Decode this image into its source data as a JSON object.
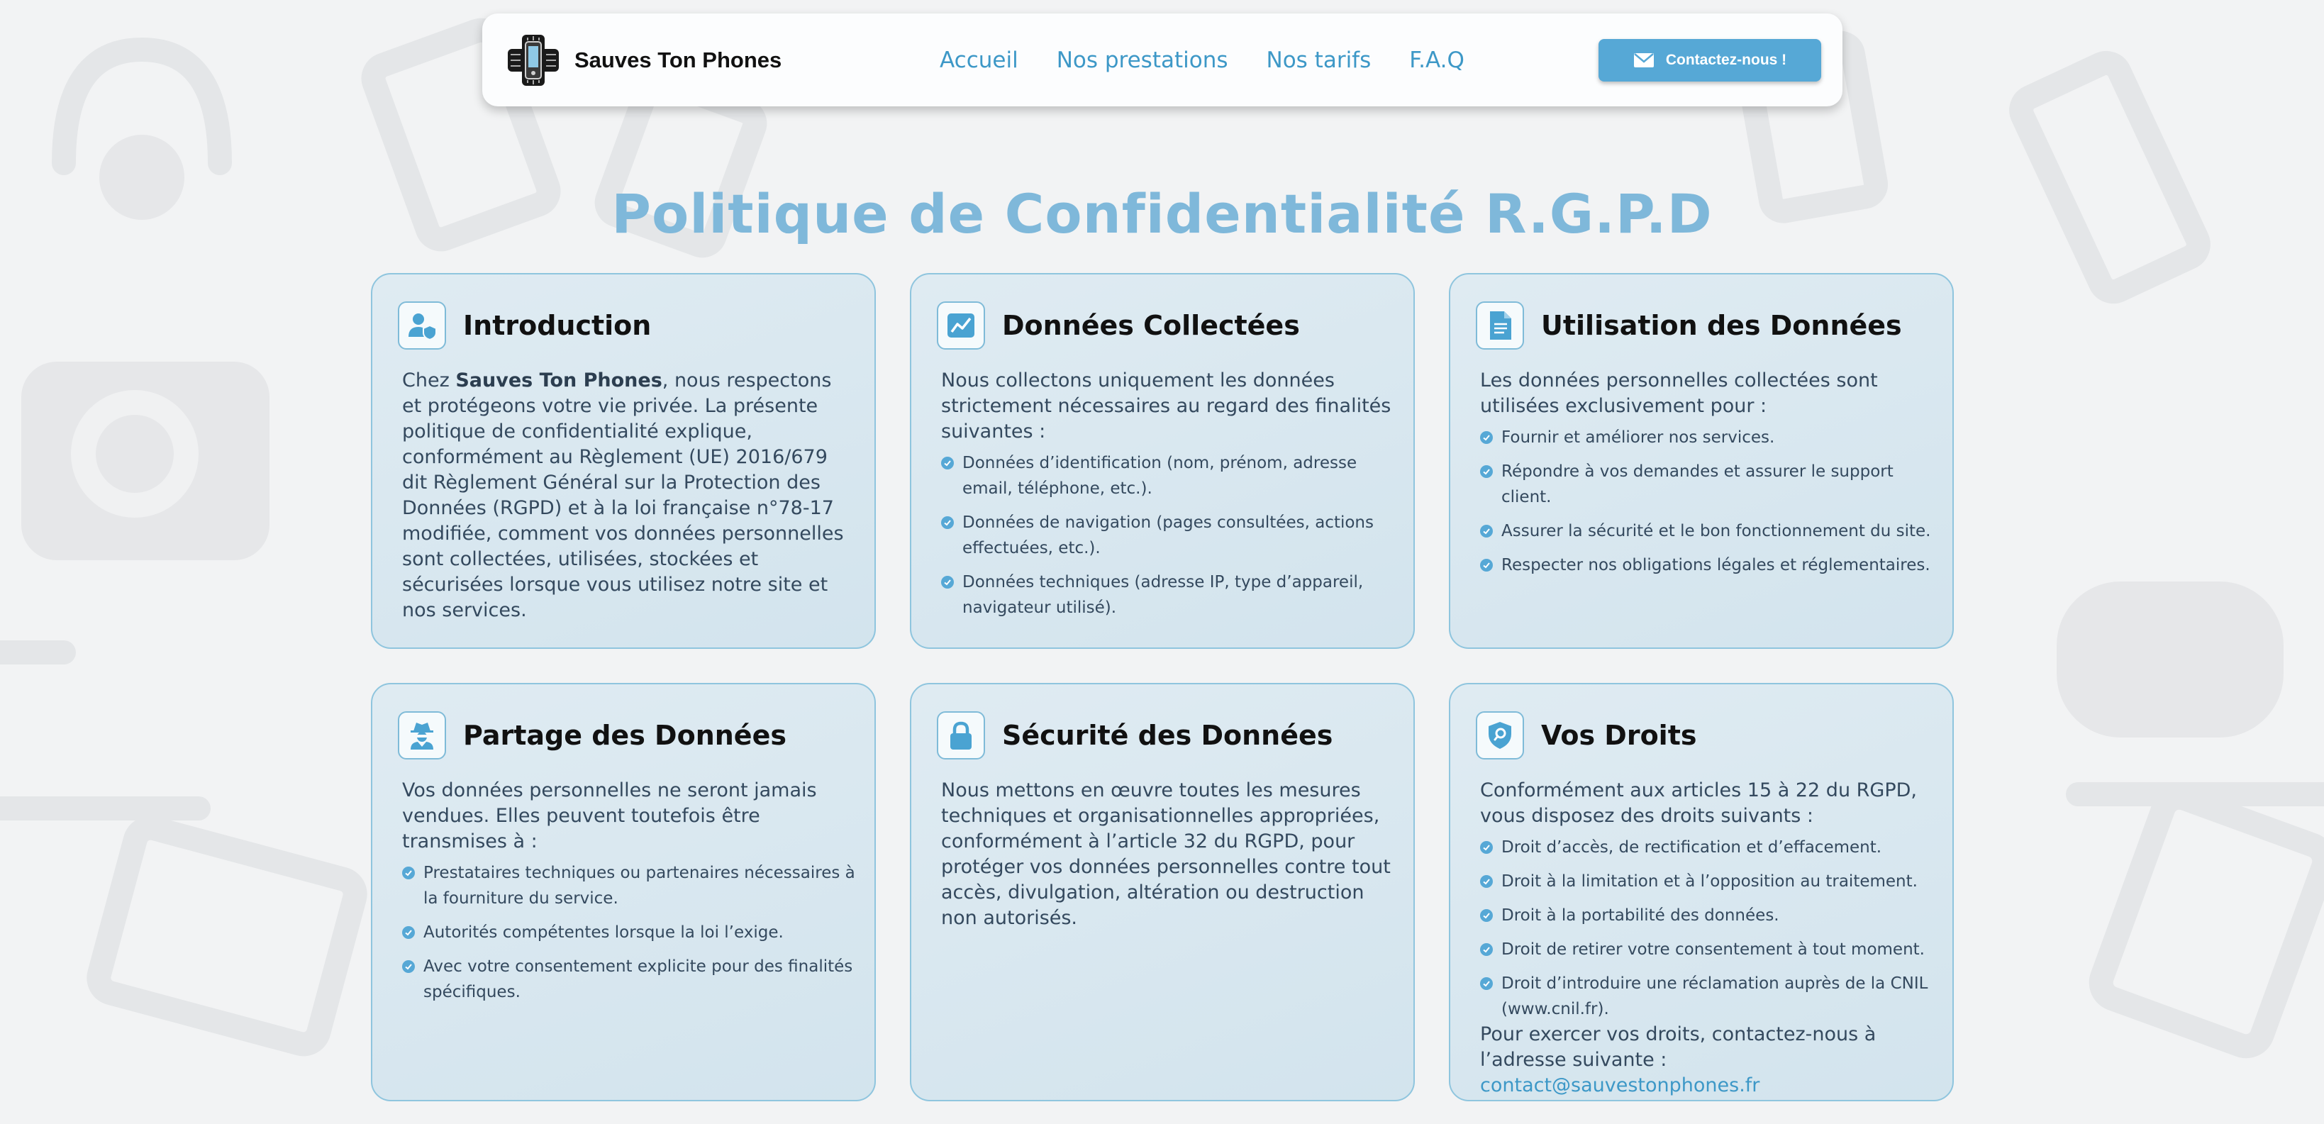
{
  "brand": {
    "name": "Sauves Ton Phones"
  },
  "nav": {
    "items": [
      "Accueil",
      "Nos prestations",
      "Nos tarifs",
      "F.A.Q"
    ],
    "contact_label": "Contactez-nous !"
  },
  "page": {
    "title": "Politique de Confidentialité R.G.P.D"
  },
  "colors": {
    "accent": "#56a8d6",
    "link": "#3d98c7",
    "title": "#7fb8da",
    "card_border": "#8fc5de"
  },
  "cards": {
    "introduction": {
      "icon": "user-shield-icon",
      "title": "Introduction",
      "text_pre": "Chez ",
      "text_bold": "Sauves Ton Phones",
      "text_post": ", nous respectons et protégeons votre vie privée. La présente politique de confidentialité explique, conformément au Règlement (UE) 2016/679 dit Règlement Général sur la Protection des Données (RGPD) et à la loi française n°78-17 modifiée, comment vos données personnelles sont collectées, utilisées, stockées et sécurisées lorsque vous utilisez notre site et nos services."
    },
    "collected": {
      "icon": "chart-line-icon",
      "title": "Données Collectées",
      "intro": "Nous collectons uniquement les données strictement nécessaires au regard des finalités suivantes :",
      "items": [
        "Données d’identification (nom, prénom, adresse email, téléphone, etc.).",
        "Données de navigation (pages consultées, actions effectuées, etc.).",
        "Données techniques (adresse IP, type d’appareil, navigateur utilisé)."
      ]
    },
    "usage": {
      "icon": "document-icon",
      "title": "Utilisation des Données",
      "intro": "Les données personnelles collectées sont utilisées exclusivement pour :",
      "items": [
        "Fournir et améliorer nos services.",
        "Répondre à vos demandes et assurer le support client.",
        "Assurer la sécurité et le bon fonctionnement du site.",
        "Respecter nos obligations légales et réglementaires."
      ]
    },
    "sharing": {
      "icon": "user-secret-icon",
      "title": "Partage des Données",
      "intro": "Vos données personnelles ne seront jamais vendues. Elles peuvent toutefois être transmises à :",
      "items": [
        "Prestataires techniques ou partenaires nécessaires à la fourniture du service.",
        "Autorités compétentes lorsque la loi l’exige.",
        "Avec votre consentement explicite pour des finalités spécifiques."
      ]
    },
    "security": {
      "icon": "lock-icon",
      "title": "Sécurité des Données",
      "text": "Nous mettons en œuvre toutes les mesures techniques et organisationnelles appropriées, conformément à l’article 32 du RGPD, pour protéger vos données personnelles contre tout accès, divulgation, altération ou destruction non autorisés."
    },
    "rights": {
      "icon": "shield-search-icon",
      "title": "Vos Droits",
      "intro": "Conformément aux articles 15 à 22 du RGPD, vous disposez des droits suivants :",
      "items": [
        "Droit d’accès, de rectification et d’effacement.",
        "Droit à la limitation et à l’opposition au traitement.",
        "Droit à la portabilité des données.",
        "Droit de retirer votre consentement à tout moment.",
        "Droit d’introduire une réclamation auprès de la CNIL (www.cnil.fr)."
      ],
      "outro": "Pour exercer vos droits, contactez-nous à l’adresse suivante : ",
      "email": "contact@sauvestonphones.fr"
    }
  }
}
